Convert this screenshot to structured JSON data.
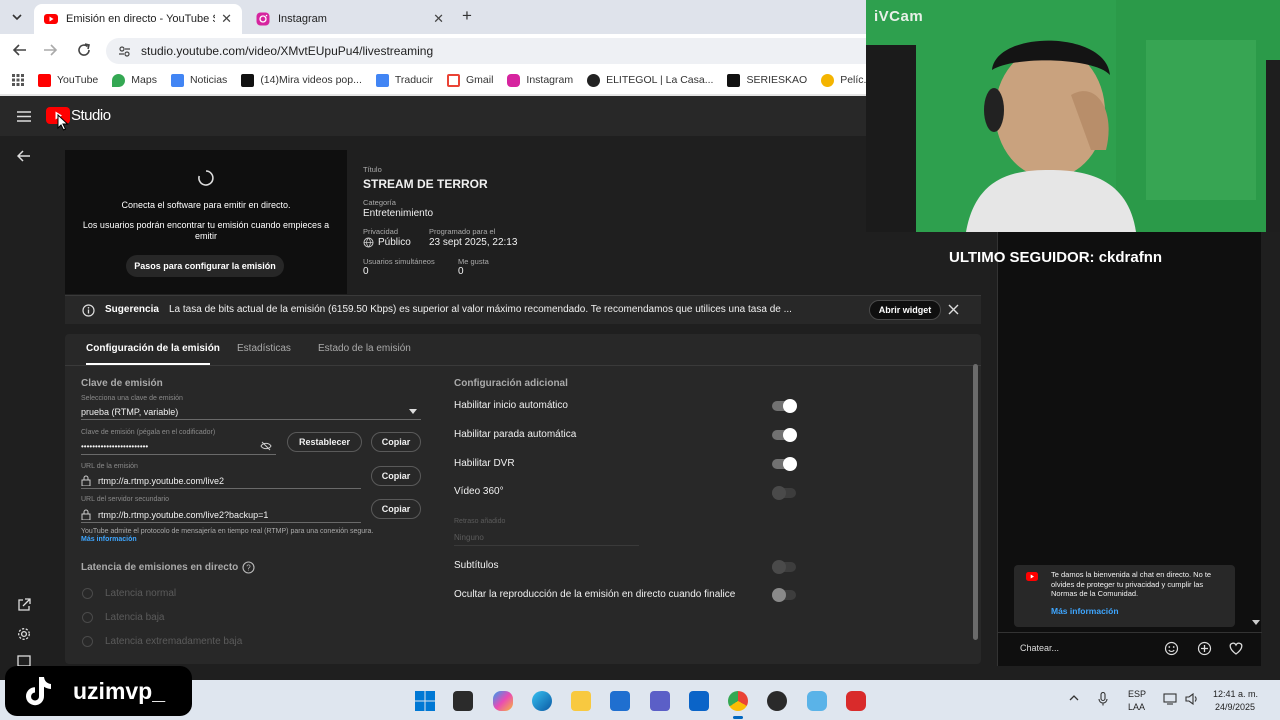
{
  "browser": {
    "tabs": [
      {
        "title": "Emisión en directo - YouTube Studio",
        "active": true,
        "icon": "youtube-icon"
      },
      {
        "title": "Instagram",
        "active": false,
        "icon": "instagram-icon"
      }
    ],
    "url": "studio.youtube.com/video/XMvtEUpuPu4/livestreaming",
    "bookmarks": [
      {
        "label": "YouTube",
        "color": "#ff0000"
      },
      {
        "label": "Maps",
        "color": "#34a853"
      },
      {
        "label": "Noticias",
        "color": "#4285f4"
      },
      {
        "label": "(14)Mira videos pop...",
        "color": "#111111"
      },
      {
        "label": "Traducir",
        "color": "#4285f4"
      },
      {
        "label": "Gmail",
        "color": "#ea4335"
      },
      {
        "label": "Instagram",
        "color": "#d6249f"
      },
      {
        "label": "ELITEGOL | La Casa...",
        "color": "#222222"
      },
      {
        "label": "SERIESKAO",
        "color": "#111111"
      },
      {
        "label": "Pelíc...",
        "color": "#f4b400"
      }
    ]
  },
  "studio": {
    "logo_text": "Studio",
    "preview": {
      "line1": "Conecta el software para emitir en directo.",
      "line2": "Los usuarios podrán encontrar tu emisión cuando empieces a emitir",
      "setup_button": "Pasos para configurar la emisión"
    },
    "details": {
      "title_label": "Título",
      "title": "STREAM DE TERROR",
      "category_label": "Categoría",
      "category": "Entretenimiento",
      "privacy_label": "Privacidad",
      "privacy": "Público",
      "scheduled_label": "Programado para el",
      "scheduled": "23 sept 2025, 22:13",
      "viewers_label": "Usuarios simultáneos",
      "viewers": "0",
      "likes_label": "Me gusta",
      "likes": "0"
    },
    "suggestion": {
      "label": "Sugerencia",
      "text": "La tasa de bits actual de la emisión (6159.50 Kbps) es superior al valor máximo recomendado. Te recomendamos que utilices una tasa de ...",
      "button": "Abrir widget"
    },
    "tabs": [
      "Configuración de la emisión",
      "Estadísticas",
      "Estado de la emisión"
    ],
    "stream_key": {
      "heading": "Clave de emisión",
      "select_label": "Selecciona una clave de emisión",
      "select_value": "prueba (RTMP, variable)",
      "key_label": "Clave de emisión (pégala en el codificador)",
      "key_value": "••••••••••••••••••••••••",
      "reset_button": "Restablecer",
      "copy_button": "Copiar",
      "url_label": "URL de la emisión",
      "url_value": "rtmp://a.rtmp.youtube.com/live2",
      "backup_label": "URL del servidor secundario",
      "backup_value": "rtmp://b.rtmp.youtube.com/live2?backup=1",
      "note": "YouTube admite el protocolo de mensajería en tiempo real (RTMP) para una conexión segura.",
      "more_info": "Más información"
    },
    "latency": {
      "heading": "Latencia de emisiones en directo",
      "options": [
        "Latencia normal",
        "Latencia baja",
        "Latencia extremadamente baja"
      ]
    },
    "additional": {
      "heading": "Configuración adicional",
      "options": [
        {
          "label": "Habilitar inicio automático",
          "on": true
        },
        {
          "label": "Habilitar parada automática",
          "on": true
        },
        {
          "label": "Habilitar DVR",
          "on": true
        },
        {
          "label": "Vídeo 360°",
          "on": false
        }
      ],
      "delay_label": "Retraso añadido",
      "delay_value": "Ninguno",
      "subtitles": "Subtítulos",
      "hide_replay": "Ocultar la reproducción de la emisión en directo cuando finalice"
    }
  },
  "overlay": {
    "cam_label": "iVCam",
    "follower": "ULTIMO SEGUIDOR: ckdrafnn",
    "welcome_text": "Te damos la bienvenida al chat en directo. No te olvides de proteger tu privacidad y cumplir las Normas de la Comunidad.",
    "welcome_link": "Más información",
    "chat_placeholder": "Chatear...",
    "tiktok_handle": "uzimvp_"
  },
  "taskbar": {
    "lang1": "ESP",
    "lang2": "LAA",
    "time": "12:41 a. m.",
    "date": "24/9/2025"
  }
}
